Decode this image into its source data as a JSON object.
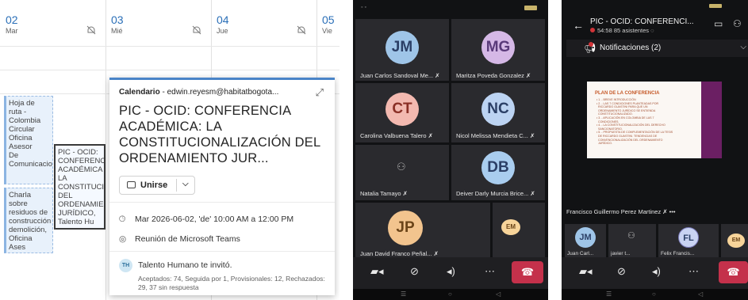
{
  "calendar": {
    "days": [
      {
        "num": "02",
        "dow": "Mar"
      },
      {
        "num": "03",
        "dow": "Mié"
      },
      {
        "num": "04",
        "dow": "Jue"
      },
      {
        "num": "05",
        "dow": "Vie"
      }
    ],
    "events": {
      "e1": "Hoja de\nruta -\nColombia\nCircular\nOficina Asesor\nDe\nComunicaciones",
      "e2": "Charla\nsobre\nresiduos de\nconstrucción\ndemolición,\nOficina Ases",
      "e3": "PIC - OCID:\nCONFERENCIA\nACADÉMICA\nLA\nCONSTITUCI\nDEL\nORDENAMIE\nJURÍDICO,\nTalento Hu"
    },
    "popup": {
      "calendar_label": "Calendario",
      "account": " - edwin.reyesm@habitatbogota...",
      "title": "PIC - OCID: CONFERENCIA ACADÉMICA: LA CONSTITUCIONALIZACIÓN DEL ORDENAMIENTO JUR...",
      "join_label": "Unirse",
      "datetime": "Mar 2026-06-02, 'de' 10:00 AM a 12:00 PM",
      "location": "Reunión de Microsoft Teams",
      "organizer_initials": "TH",
      "invite_text": "Talento Humano te invitó.",
      "responses": "Aceptados: 74, Seguida por 1, Provisionales: 12, Rechazados: 29, 37 sin respuesta"
    }
  },
  "phone1": {
    "participants": [
      {
        "initials": "JM",
        "name": "Juan Carlos Sandoval Me...",
        "color": "#9fc5e8"
      },
      {
        "initials": "MG",
        "name": "Maritza Poveda Gonzalez",
        "color": "#d5b8e6"
      },
      {
        "initials": "CT",
        "name": "Carolina Valbuena Talero",
        "color": "#f3b9b0"
      },
      {
        "initials": "NC",
        "name": "Nicol Melissa Mendieta C...",
        "color": "#bcd3f2"
      },
      {
        "initials": "",
        "name": "Natalia Tamayo",
        "color": "#2a2a2e"
      },
      {
        "initials": "DB",
        "name": "Deiver Darly Murcia Brice...",
        "color": "#a9cdef"
      },
      {
        "initials": "JP",
        "name": "Juan David Franco Peñal...",
        "color": "#f2c48e"
      },
      {
        "initials": "EM",
        "name": "",
        "color": "#f7d49a"
      }
    ]
  },
  "phone2": {
    "title": "PIC - OCID: CONFERENCI...",
    "subtitle": "54:58  85 asistentes",
    "notifications": "Notificaciones (2)",
    "slide": {
      "title": "PLAN DE LA CONFERENCIA",
      "text": "• 1. - BREVE INTRODUCCIÓN\n• 2. - LAS 7 CONDICIONES PLANTEADAS POR\n  RICCARDO GUASTINI PARA QUE UN\n  ORDENAMIENTO JURÍDICO SE ENTIENDA\n  CONSTITUCIONALIZADO.\n• 3. - APLICACIÓN EN COLOMBIA DE LAS 7\n  CONDICIONES.\n• 4. - LA CONSTITUCIONALIZACIÓN DEL DERECHO\n  SANCIONATORIO.\n• 5. - PROPUESTA DE COMPLEMENTACIÓN DE LA TESIS\n  DE RICCARDO GUASTINI. TENDENCIAS DE\n  CONVENCIONALIZACIÓN DEL ORDENAMIENTO\n  JURÍDICO."
    },
    "speaker": "Francisco Guillermo Perez Martinez",
    "mini": [
      {
        "initials": "JM",
        "name": "Juan Carl...",
        "color": "#9fc5e8"
      },
      {
        "initials": "",
        "name": "javier t...",
        "color": "#2a2a2e"
      },
      {
        "initials": "FL",
        "name": "Felix Francis...",
        "color": "#c9d3f2"
      },
      {
        "initials": "EM",
        "name": "",
        "color": "#f7d49a"
      }
    ]
  }
}
